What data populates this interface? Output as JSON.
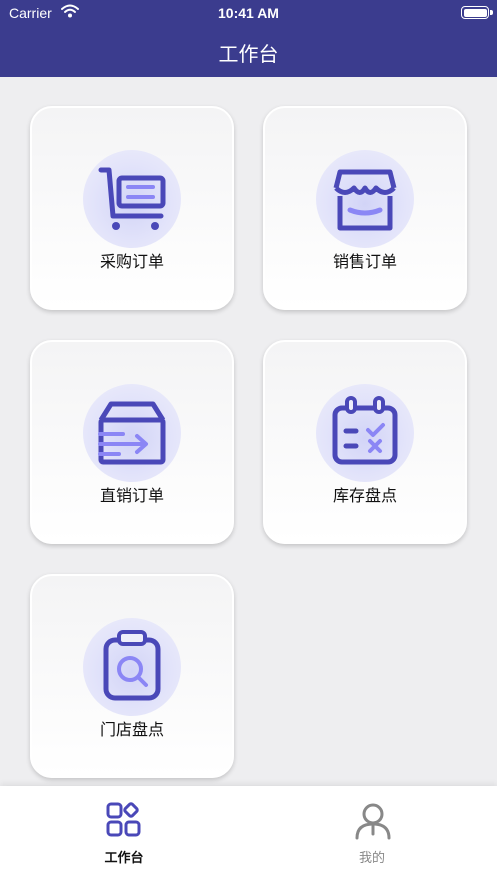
{
  "status_bar": {
    "carrier": "Carrier",
    "time": "10:41 AM"
  },
  "header": {
    "title": "工作台"
  },
  "grid": {
    "items": [
      {
        "label": "采购订单",
        "icon": "shopping-cart-icon"
      },
      {
        "label": "销售订单",
        "icon": "storefront-icon"
      },
      {
        "label": "直销订单",
        "icon": "box-arrow-icon"
      },
      {
        "label": "库存盘点",
        "icon": "calendar-check-icon"
      },
      {
        "label": "门店盘点",
        "icon": "clipboard-search-icon"
      }
    ]
  },
  "tabbar": {
    "tabs": [
      {
        "label": "工作台",
        "icon": "grid-icon",
        "active": true
      },
      {
        "label": "我的",
        "icon": "person-icon",
        "active": false
      }
    ]
  },
  "colors": {
    "header_bg": "#3b3c8e",
    "accent": "#4a48b8",
    "accent_light": "#8b86f5"
  }
}
